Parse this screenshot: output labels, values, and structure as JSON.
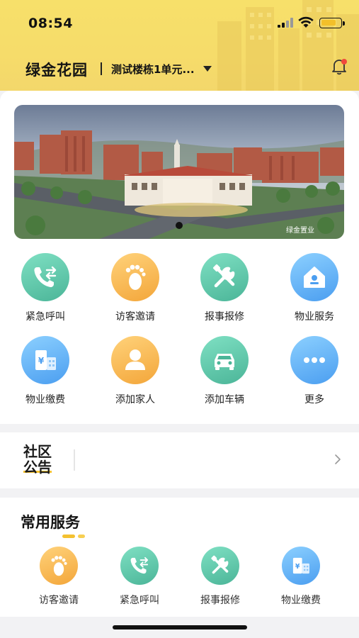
{
  "status_bar": {
    "time": "08:54"
  },
  "header": {
    "community_name": "绿金花园",
    "building": "测试楼栋1单元..."
  },
  "banner": {
    "watermark": "绿金置业"
  },
  "grid": {
    "items": [
      {
        "label": "紧急呼叫",
        "icon": "phone-transfer-icon",
        "color": "#5cc9a9"
      },
      {
        "label": "访客邀请",
        "icon": "footprint-icon",
        "color": "#f6b64a"
      },
      {
        "label": "报事报修",
        "icon": "tools-icon",
        "color": "#5cc9a9"
      },
      {
        "label": "物业服务",
        "icon": "home-icon",
        "color": "#5aa9f4"
      },
      {
        "label": "物业缴费",
        "icon": "bill-building-icon",
        "color": "#5aa9f4"
      },
      {
        "label": "添加家人",
        "icon": "person-icon",
        "color": "#f6b64a"
      },
      {
        "label": "添加车辆",
        "icon": "car-icon",
        "color": "#5cc9a9"
      },
      {
        "label": "更多",
        "icon": "more-dots-icon",
        "color": "#5aa9f4"
      }
    ]
  },
  "notice": {
    "title_line1": "社区",
    "title_line2": "公告"
  },
  "services": {
    "title": "常用服务",
    "items": [
      {
        "label": "访客邀请",
        "icon": "footprint-icon"
      },
      {
        "label": "紧急呼叫",
        "icon": "phone-transfer-icon"
      },
      {
        "label": "报事报修",
        "icon": "tools-icon"
      },
      {
        "label": "物业缴费",
        "icon": "bill-building-icon"
      }
    ]
  },
  "colors": {
    "header_yellow": "#f6dc6a",
    "teal": "#5cc9a9",
    "orange": "#f6b64a",
    "blue": "#5aa9f4"
  }
}
